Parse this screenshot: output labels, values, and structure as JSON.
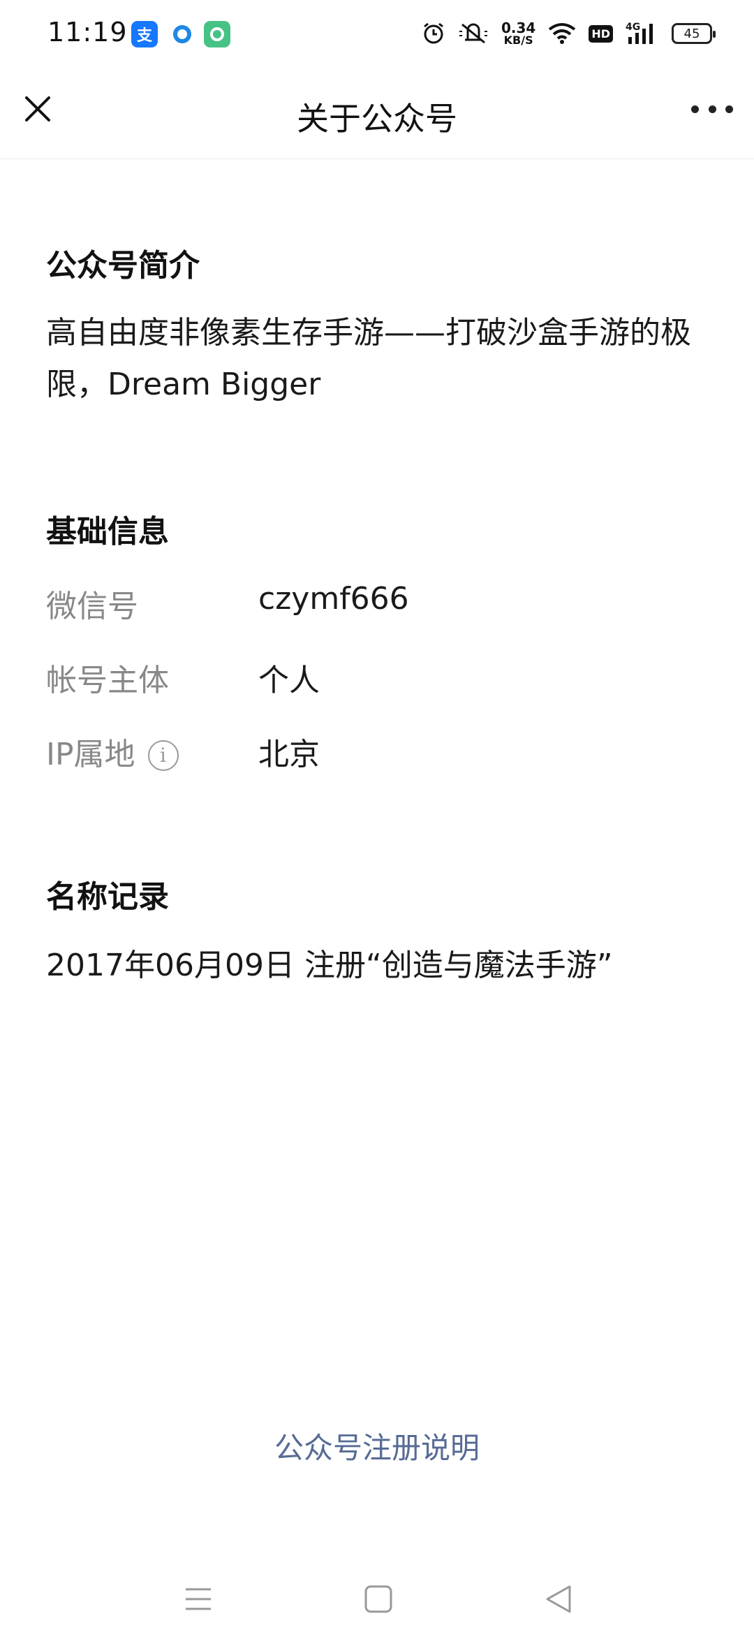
{
  "status_bar": {
    "time": "11:19",
    "net_speed_value": "0.34",
    "net_speed_unit": "KB/S",
    "hd_label": "HD",
    "network_label": "4G",
    "battery_level": "45",
    "alipay_glyph": "支"
  },
  "nav": {
    "title": "关于公众号"
  },
  "intro": {
    "heading": "公众号简介",
    "text": "高自由度非像素生存手游——打破沙盒手游的极限，Dream Bigger"
  },
  "basic_info": {
    "heading": "基础信息",
    "wechat_id_label": "微信号",
    "wechat_id_value": "czymf666",
    "account_subject_label": "帐号主体",
    "account_subject_value": "个人",
    "ip_label": "IP属地",
    "ip_value": "北京",
    "info_icon_glyph": "i"
  },
  "name_record": {
    "heading": "名称记录",
    "entry": "2017年06月09日 注册“创造与魔法手游”"
  },
  "footer": {
    "link": "公众号注册说明"
  },
  "colors": {
    "link": "#576b95",
    "label_gray": "#888888",
    "alipay_blue": "#1677ff",
    "green_app": "#46c285"
  },
  "icons": [
    "alipay-icon",
    "browser-icon",
    "green-app-icon",
    "alarm-icon",
    "mute-icon",
    "wifi-icon",
    "signal-icon",
    "battery-icon",
    "close-icon",
    "more-icon",
    "info-icon",
    "menu-icon",
    "home-icon",
    "back-icon"
  ]
}
